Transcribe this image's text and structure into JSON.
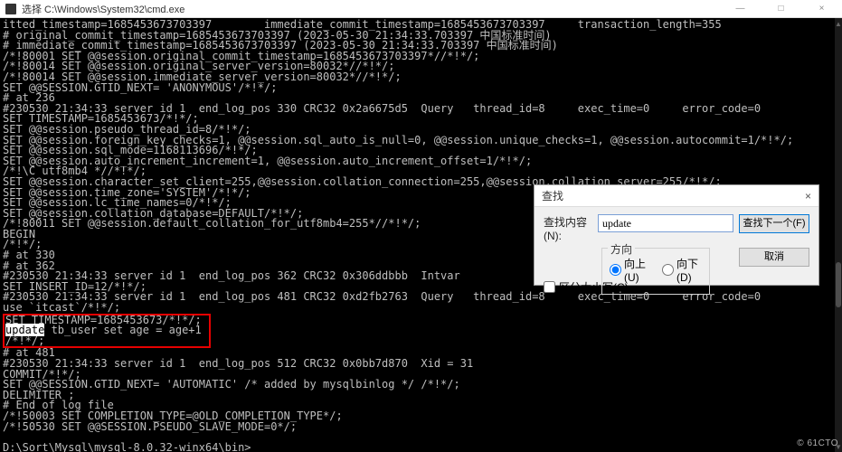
{
  "window": {
    "title": "选择 C:\\Windows\\System32\\cmd.exe",
    "minimize": "—",
    "maximize": "□",
    "close": "×"
  },
  "terminal": {
    "lines": [
      "itted_timestamp=1685453673703397\timmediate_commit_timestamp=1685453673703397\ttransaction_length=355",
      "# original_commit_timestamp=1685453673703397 (2023-05-30 21:34:33.703397 中国标准时间)",
      "# immediate_commit_timestamp=1685453673703397 (2023-05-30 21:34:33.703397 中国标准时间)",
      "/*!80001 SET @@session.original_commit_timestamp=1685453673703397*//*!*/;",
      "/*!80014 SET @@session.original_server_version=80032*//*!*/;",
      "/*!80014 SET @@session.immediate_server_version=80032*//*!*/;",
      "SET @@SESSION.GTID_NEXT= 'ANONYMOUS'/*!*/;",
      "# at 236",
      "#230530 21:34:33 server id 1  end_log_pos 330 CRC32 0x2a6675d5  Query   thread_id=8     exec_time=0     error_code=0",
      "SET TIMESTAMP=1685453673/*!*/;",
      "SET @@session.pseudo_thread_id=8/*!*/;",
      "SET @@session.foreign_key_checks=1, @@session.sql_auto_is_null=0, @@session.unique_checks=1, @@session.autocommit=1/*!*/;",
      "SET @@session.sql_mode=1168113696/*!*/;",
      "SET @@session.auto_increment_increment=1, @@session.auto_increment_offset=1/*!*/;",
      "/*!\\C utf8mb4 *//*!*/;",
      "SET @@session.character_set_client=255,@@session.collation_connection=255,@@session.collation_server=255/*!*/;",
      "SET @@session.time_zone='SYSTEM'/*!*/;",
      "SET @@session.lc_time_names=0/*!*/;",
      "SET @@session.collation_database=DEFAULT/*!*/;",
      "/*!80011 SET @@session.default_collation_for_utf8mb4=255*//*!*/;",
      "BEGIN",
      "/*!*/;",
      "# at 330",
      "# at 362",
      "#230530 21:34:33 server id 1  end_log_pos 362 CRC32 0x306ddbbb  Intvar",
      "SET INSERT_ID=12/*!*/;",
      "#230530 21:34:33 server id 1  end_log_pos 481 CRC32 0xd2fb2763  Query   thread_id=8     exec_time=0     error_code=0",
      "use `itcast`/*!*/;"
    ],
    "highlight_block": [
      "SET TIMESTAMP=1685453673/*!*/;",
      "update tb_user set age = age+1 ",
      "/*!*/;"
    ],
    "selected_word": "update",
    "rest_of_line2": " tb_user set age = age+1 ",
    "lines_after": [
      "# at 481",
      "#230530 21:34:33 server id 1  end_log_pos 512 CRC32 0x0bb7d870  Xid = 31",
      "COMMIT/*!*/;",
      "SET @@SESSION.GTID_NEXT= 'AUTOMATIC' /* added by mysqlbinlog */ /*!*/;",
      "DELIMITER ;",
      "# End of log file",
      "/*!50003 SET COMPLETION_TYPE=@OLD_COMPLETION_TYPE*/;",
      "/*!50530 SET @@SESSION.PSEUDO_SLAVE_MODE=0*/;",
      "",
      "D:\\Sort\\Mysql\\mysql-8.0.32-winx64\\bin>"
    ]
  },
  "find": {
    "title": "查找",
    "close": "×",
    "label": "查找内容(N):",
    "value": "update",
    "find_next_btn": "查找下一个(F)",
    "cancel_btn": "取消",
    "direction_legend": "方向",
    "up_label": "向上(U)",
    "down_label": "向下(D)",
    "match_case": "区分大小写(C)"
  },
  "watermark": "© 61CTO"
}
